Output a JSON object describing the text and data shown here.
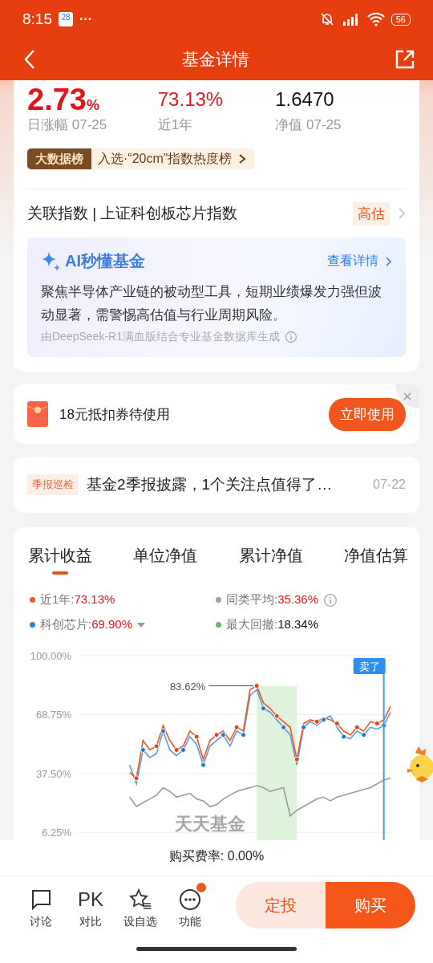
{
  "status_bar": {
    "time": "8:15",
    "calendar_day": "28",
    "more": "···",
    "battery": "56"
  },
  "header": {
    "title": "基金详情"
  },
  "summary": {
    "stats": [
      {
        "value": "2.73",
        "unit": "%",
        "label": "日涨幅 07-25",
        "highlight": true,
        "kind": "big"
      },
      {
        "value": "73.13%",
        "label": "近1年",
        "highlight": true,
        "kind": "normal"
      },
      {
        "value": "1.6470",
        "label": "净值 07-25",
        "highlight": false,
        "kind": "normal"
      }
    ],
    "ranking": {
      "badge": "大数据榜",
      "text": "入选·“20cm”指数热度榜"
    },
    "related_index": {
      "label": "关联指数 | 上证科创板芯片指数",
      "tag": "高估"
    },
    "ai_card": {
      "title": "AI秒懂基金",
      "link": "查看详情",
      "body": "聚焦半导体产业链的被动型工具，短期业绩爆发力强但波动显著，需警惕高估值与行业周期风险。",
      "source": "由DeepSeek-R1满血版结合专业基金数据库生成"
    }
  },
  "coupon": {
    "text": "18元抵扣券待使用",
    "button": "立即使用"
  },
  "news": {
    "tag": "季报巡检",
    "title": "基金2季报披露，1个关注点值得了…",
    "date": "07-22"
  },
  "chart_tabs": [
    {
      "label": "累计收益",
      "selected": true
    },
    {
      "label": "单位净值",
      "selected": false
    },
    {
      "label": "累计净值",
      "selected": false
    },
    {
      "label": "净值估算",
      "selected": false
    }
  ],
  "legend": [
    {
      "name": "近1年:",
      "value": "73.13%",
      "color": "#f0561d",
      "highlight": true,
      "kind": "plain"
    },
    {
      "name": "同类平均:",
      "value": "35.36%",
      "color": "#a0a0a0",
      "highlight": true,
      "kind": "info"
    },
    {
      "name": "科创芯片:",
      "value": "69.90%",
      "color": "#2a86e0",
      "highlight": true,
      "kind": "dropdown"
    },
    {
      "name": "最大回撤:",
      "value": "18.34%",
      "color": "#5cc05c",
      "highlight": false,
      "kind": "plain"
    }
  ],
  "chart": {
    "watermark": "天天基金",
    "peak_label": "83.62%",
    "sell_tag": "卖了",
    "chart_data": {
      "type": "line",
      "grid": true,
      "ylim": [
        0,
        100
      ],
      "yticks": [
        {
          "value": 6.25,
          "label": "6.25%"
        },
        {
          "value": 37.5,
          "label": "37.50%"
        },
        {
          "value": 68.75,
          "label": "68.75%"
        },
        {
          "value": 100,
          "label": "100.00%"
        }
      ],
      "series": [
        {
          "color": "#f0561d",
          "values": [
            null,
            null,
            null,
            null,
            null,
            null,
            null,
            null,
            38,
            35,
            55,
            50,
            52,
            63,
            55,
            50,
            52,
            60,
            57,
            45,
            55,
            58,
            60,
            55,
            62,
            60,
            82,
            84,
            75,
            72,
            68,
            65,
            62,
            45,
            64,
            66,
            65,
            67,
            66,
            64,
            60,
            58,
            62,
            60,
            65,
            64,
            66,
            73
          ]
        },
        {
          "color": "#5a9ae6",
          "values": [
            null,
            null,
            null,
            null,
            null,
            null,
            null,
            null,
            42,
            32,
            50,
            46,
            48,
            60,
            50,
            47,
            50,
            57,
            53,
            42,
            52,
            55,
            58,
            52,
            60,
            58,
            79,
            82,
            72,
            70,
            66,
            62,
            58,
            42,
            62,
            65,
            63,
            66,
            68,
            62,
            57,
            56,
            60,
            58,
            62,
            61,
            63,
            70
          ]
        },
        {
          "color": "#9a9a9a",
          "values": [
            null,
            null,
            null,
            null,
            null,
            null,
            null,
            null,
            25,
            20,
            22,
            24,
            26,
            30,
            28,
            25,
            26,
            27,
            24,
            23,
            20,
            21,
            24,
            26,
            28,
            29,
            30,
            31,
            30,
            28,
            29,
            30,
            15,
            18,
            20,
            22,
            24,
            25,
            23,
            25,
            26,
            27,
            28,
            29,
            30,
            32,
            34,
            35
          ]
        }
      ]
    }
  },
  "fee": "购买费率: 0.00%",
  "nav": [
    {
      "label": "讨论",
      "kind": "chat",
      "badge": false
    },
    {
      "label": "对比",
      "kind": "pk",
      "glyph": "PK",
      "badge": false
    },
    {
      "label": "设自选",
      "kind": "star",
      "badge": false
    },
    {
      "label": "功能",
      "kind": "more",
      "badge": true
    }
  ],
  "actions": {
    "secondary": "定投",
    "primary": "购买"
  }
}
